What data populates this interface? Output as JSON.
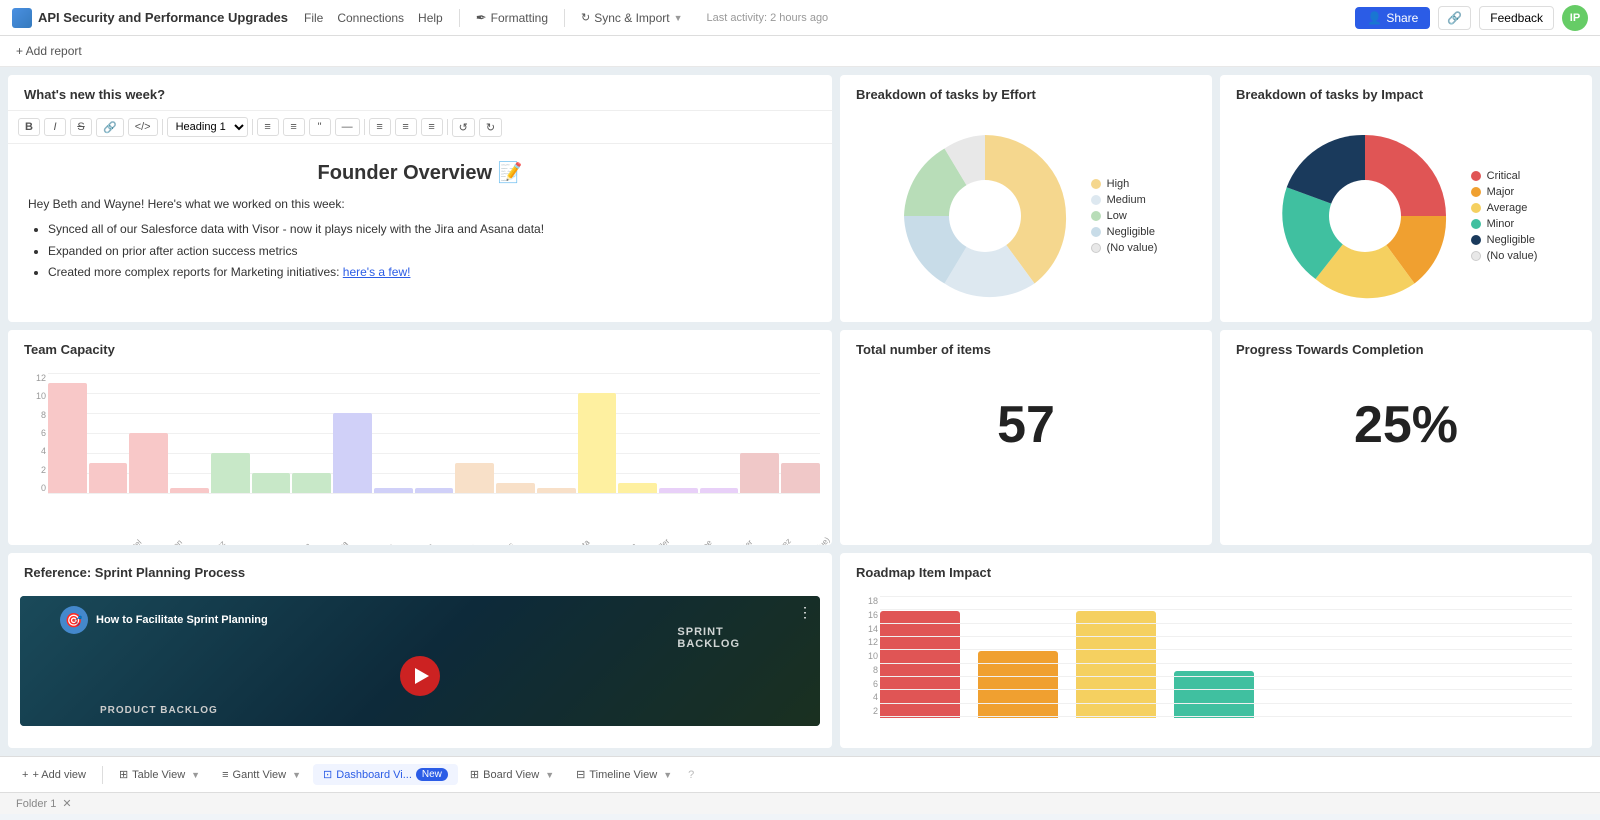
{
  "topbar": {
    "title": "API Security and Performance Upgrades",
    "nav": [
      "File",
      "Connections",
      "Help"
    ],
    "formatting": "Formatting",
    "sync": "Sync & Import",
    "activity": "Last activity: 2 hours ago",
    "share_label": "Share",
    "feedback_label": "Feedback",
    "avatar_initials": "IP"
  },
  "add_report": {
    "label": "+ Add report"
  },
  "whats_new": {
    "title": "What's new this week?",
    "editor_title": "Founder Overview 📝",
    "intro": "Hey Beth and Wayne! Here's what we worked on this week:",
    "bullets": [
      "Synced all of our Salesforce data with Visor - now it plays nicely with the Jira and Asana data!",
      "Expanded on prior after action success metrics",
      "Created more complex reports for Marketing initiatives: here's a few!"
    ],
    "link_text": "here's a few!",
    "toolbar": {
      "bold": "B",
      "italic": "I",
      "strikethrough": "S",
      "link": "🔗",
      "code": "</>",
      "heading": "Heading 1",
      "bullets_ol": "☰",
      "bullets_ul": "≡",
      "quote": "❝",
      "divider": "—",
      "align_left": "≡",
      "align_center": "≡",
      "align_right": "≡",
      "undo": "↺",
      "redo": "↻"
    }
  },
  "team_capacity": {
    "title": "Team Capacity",
    "y_labels": [
      "12",
      "10",
      "8",
      "6",
      "4",
      "2",
      "0"
    ],
    "bars": [
      {
        "name": "Samantha Chen",
        "value": 11,
        "color": "#f8c8c8"
      },
      {
        "name": "Jordan Patel",
        "value": 3,
        "color": "#f8c8c8"
      },
      {
        "name": "Aisha Green",
        "value": 6,
        "color": "#f8c8c8"
      },
      {
        "name": "Luis Martinez",
        "value": 0.5,
        "color": "#f8c8c8"
      },
      {
        "name": "Emily Nakamura",
        "value": 4,
        "color": "#c8e8c8"
      },
      {
        "name": "Grace Johnson",
        "value": 2,
        "color": "#c8e8c8"
      },
      {
        "name": "Carlos Rivera",
        "value": 2,
        "color": "#c8e8c8"
      },
      {
        "name": "Zara Thompson",
        "value": 8,
        "color": "#d0d0f8"
      },
      {
        "name": "Maya Robinson",
        "value": 0.5,
        "color": "#d0d0f8"
      },
      {
        "name": "Nina Hernandez",
        "value": 0.5,
        "color": "#d0d0f8"
      },
      {
        "name": "Ethan Williams",
        "value": 3,
        "color": "#f8e0c8"
      },
      {
        "name": "Isabella Rodriguez",
        "value": 1,
        "color": "#f8e0c8"
      },
      {
        "name": "Rahul Gupta",
        "value": 0.5,
        "color": "#f8e0c8"
      },
      {
        "name": "Sophia Nguyen",
        "value": 10,
        "color": "#fef0a0"
      },
      {
        "name": "Aiden Miller",
        "value": 1,
        "color": "#fef0a0"
      },
      {
        "name": "Jasmine Lee",
        "value": 0.5,
        "color": "#e8d0f8"
      },
      {
        "name": "Dylan Carter",
        "value": 0.5,
        "color": "#e8d0f8"
      },
      {
        "name": "Lena Perez",
        "value": 4,
        "color": "#f0c8c8"
      },
      {
        "name": "(No Value)",
        "value": 3,
        "color": "#f0c8c8"
      }
    ],
    "max_value": 12
  },
  "effort_chart": {
    "title": "Breakdown of tasks by Effort",
    "legend": [
      {
        "label": "High",
        "color": "#f5d78e"
      },
      {
        "label": "Medium",
        "color": "#dde8f0"
      },
      {
        "label": "Low",
        "color": "#b8ddb8"
      },
      {
        "label": "Negligible",
        "color": "#c8dce8"
      },
      {
        "label": "(No value)",
        "color": "#e8e8e8"
      }
    ],
    "slices": [
      {
        "label": "High",
        "color": "#f5d78e",
        "startAngle": 0,
        "endAngle": 140
      },
      {
        "label": "Medium",
        "color": "#dde8f0",
        "startAngle": 140,
        "endAngle": 200
      },
      {
        "label": "Low",
        "color": "#b8ddb8",
        "startAngle": 200,
        "endAngle": 330
      },
      {
        "label": "Negligible",
        "color": "#c8dce8",
        "startAngle": 330,
        "endAngle": 360
      },
      {
        "label": "(No value)",
        "color": "#e8e8e8",
        "startAngle": 360,
        "endAngle": 400
      }
    ]
  },
  "impact_chart": {
    "title": "Breakdown of tasks by Impact",
    "legend": [
      {
        "label": "Critical",
        "color": "#e05555"
      },
      {
        "label": "Major",
        "color": "#f0a030"
      },
      {
        "label": "Average",
        "color": "#f5d060"
      },
      {
        "label": "Minor",
        "color": "#40c0a0"
      },
      {
        "label": "Negligible",
        "color": "#1a3a5c"
      },
      {
        "label": "(No value)",
        "color": "#e8e8e8"
      }
    ]
  },
  "total_items": {
    "title": "Total number of items",
    "value": "57"
  },
  "progress": {
    "title": "Progress Towards Completion",
    "value": "25%"
  },
  "reference": {
    "title": "Reference: Sprint Planning Process",
    "video_title": "How to Facilitate Sprint Planning",
    "video_subtitle": "SPRINT BACKLOG"
  },
  "roadmap": {
    "title": "Roadmap Item Impact",
    "y_labels": [
      "18",
      "16",
      "14",
      "12",
      "10",
      "8",
      "6",
      "4",
      "2"
    ],
    "bars": [
      {
        "color": "#e05555",
        "value": 16
      },
      {
        "color": "#f0a030",
        "value": 10
      },
      {
        "color": "#f5d060",
        "value": 16
      },
      {
        "color": "#40c0a0",
        "value": 7
      }
    ],
    "max_value": 18
  },
  "bottom_tabs": {
    "items": [
      {
        "label": "+ Add view",
        "icon": "+",
        "active": false
      },
      {
        "label": "Table View",
        "icon": "⊞",
        "active": false
      },
      {
        "label": "Gantt View",
        "icon": "≡",
        "active": false
      },
      {
        "label": "Dashboard Vi...",
        "icon": "⊡",
        "active": true,
        "badge": "New"
      },
      {
        "label": "Board View",
        "icon": "⊞",
        "active": false
      },
      {
        "label": "Timeline View",
        "icon": "⊟",
        "active": false
      }
    ]
  },
  "footer": {
    "label": "Folder 1"
  }
}
